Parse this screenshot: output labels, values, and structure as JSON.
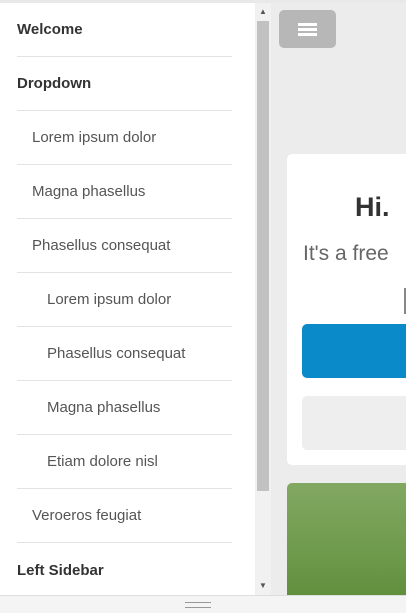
{
  "sidebar": {
    "items": [
      {
        "label": "Welcome"
      },
      {
        "label": "Dropdown"
      },
      {
        "label": "Lorem ipsum dolor"
      },
      {
        "label": "Magna phasellus"
      },
      {
        "label": "Phasellus consequat"
      },
      {
        "label": "Lorem ipsum dolor"
      },
      {
        "label": "Phasellus consequat"
      },
      {
        "label": "Magna phasellus"
      },
      {
        "label": "Etiam dolore nisl"
      },
      {
        "label": "Veroeros feugiat"
      },
      {
        "label": "Left Sidebar"
      }
    ]
  },
  "banner": {
    "title": "Hi.",
    "text": "It's a free"
  },
  "colors": {
    "primary_button": "#0b8ac9",
    "page_background": "#ececec",
    "sidebar_background": "#ffffff"
  },
  "icons": {
    "menu_toggle": "hamburger-menu-icon",
    "scroll_up": "triangle-up-icon",
    "scroll_down": "triangle-down-icon",
    "resize": "resize-grip-icon"
  }
}
